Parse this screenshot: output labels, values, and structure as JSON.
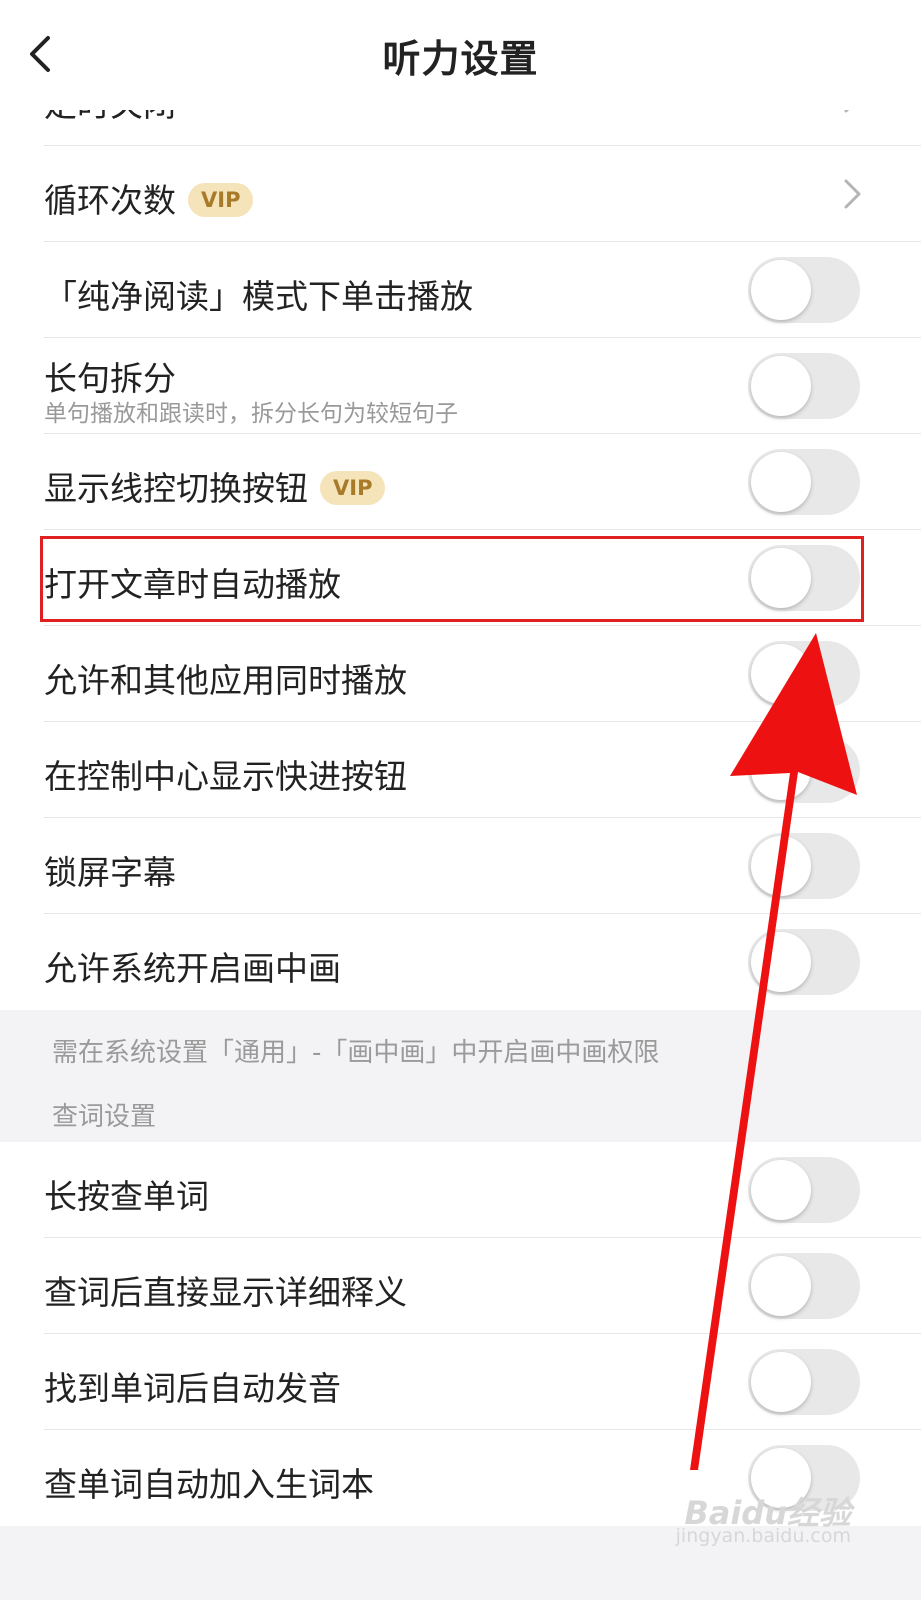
{
  "header": {
    "title": "听力设置"
  },
  "rows": [
    {
      "label": "定时关闭",
      "type": "nav"
    },
    {
      "label": "循环次数",
      "vip": "VIP",
      "type": "nav"
    },
    {
      "label": "「纯净阅读」模式下单击播放",
      "type": "toggle",
      "on": false
    },
    {
      "label": "长句拆分",
      "sub": "单句播放和跟读时，拆分长句为较短句子",
      "type": "toggle",
      "on": false
    },
    {
      "label": "显示线控切换按钮",
      "vip": "VIP",
      "type": "toggle",
      "on": false
    },
    {
      "label": "打开文章时自动播放",
      "type": "toggle",
      "on": false,
      "highlighted": true
    },
    {
      "label": "允许和其他应用同时播放",
      "type": "toggle",
      "on": false
    },
    {
      "label": "在控制中心显示快进按钮",
      "type": "toggle",
      "on": false
    },
    {
      "label": "锁屏字幕",
      "type": "toggle",
      "on": false
    },
    {
      "label": "允许系统开启画中画",
      "type": "toggle",
      "on": false
    }
  ],
  "pip_note": "需在系统设置「通用」-「画中画」中开启画中画权限",
  "lookup_section": {
    "title": "查词设置",
    "rows": [
      {
        "label": "长按查单词",
        "type": "toggle",
        "on": false
      },
      {
        "label": "查词后直接显示详细释义",
        "type": "toggle",
        "on": false
      },
      {
        "label": "找到单词后自动发音",
        "type": "toggle",
        "on": false
      },
      {
        "label": "查单词自动加入生词本",
        "type": "toggle",
        "on": false
      }
    ]
  },
  "watermark": {
    "brand": "Baidu经验",
    "url": "jingyan.baidu.com"
  },
  "colors": {
    "annotation": "#e02020",
    "vip_bg": "#f5e3ba",
    "vip_text": "#a87b2a",
    "toggle_off": "#e8e8e8"
  }
}
